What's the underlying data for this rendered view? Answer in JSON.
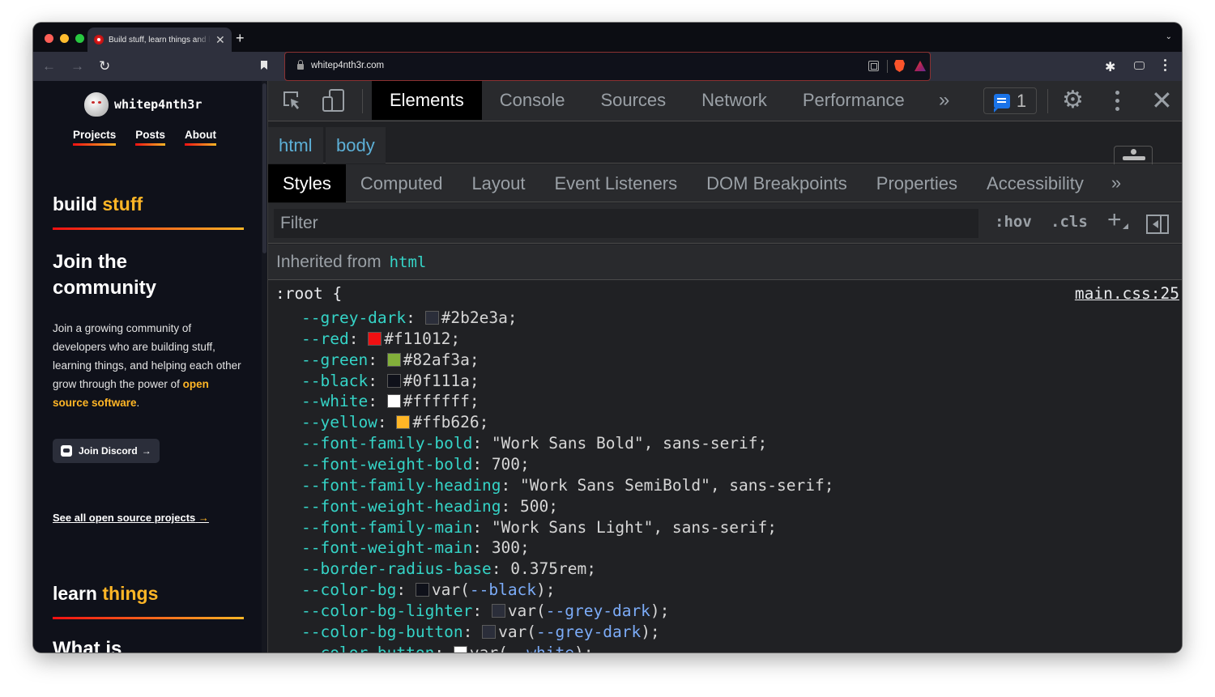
{
  "browser": {
    "tab_title": "Build stuff, learn things and love what you do",
    "new_tab_label": "+",
    "url": "whitep4nth3r.com"
  },
  "site": {
    "logo_text": "whitep4nth3r",
    "nav": [
      {
        "label": "Projects"
      },
      {
        "label": "Posts"
      },
      {
        "label": "About"
      }
    ],
    "section1": {
      "title_plain": "build",
      "title_highlight": "stuff"
    },
    "join_heading": "Join the community",
    "join_text_prefix": "Join a growing community of developers who are building stuff, learning things, and helping each other grow through the power of",
    "join_text_highlight": "open source software",
    "join_text_suffix": ".",
    "discord_button": "Join Discord",
    "discord_arrow": "→",
    "see_all_link": "See all open source projects",
    "see_all_arrow": "→",
    "section2": {
      "title_plain": "learn",
      "title_highlight": "things"
    },
    "what_is": "What is"
  },
  "devtools": {
    "tabs": [
      {
        "label": "Elements",
        "active": true
      },
      {
        "label": "Console",
        "active": false
      },
      {
        "label": "Sources",
        "active": false
      },
      {
        "label": "Network",
        "active": false
      },
      {
        "label": "Performance",
        "active": false
      }
    ],
    "more_tabs": "»",
    "issues_count": "1",
    "breadcrumbs": [
      {
        "label": "html"
      },
      {
        "label": "body"
      }
    ],
    "sub_tabs": [
      {
        "label": "Styles",
        "active": true
      },
      {
        "label": "Computed",
        "active": false
      },
      {
        "label": "Layout",
        "active": false
      },
      {
        "label": "Event Listeners",
        "active": false
      },
      {
        "label": "DOM Breakpoints",
        "active": false
      },
      {
        "label": "Properties",
        "active": false
      },
      {
        "label": "Accessibility",
        "active": false
      }
    ],
    "sub_more": "»",
    "filter_placeholder": "Filter",
    "hov_label": ":hov",
    "cls_label": ".cls",
    "inherited_label": "Inherited from",
    "inherited_tag": "html",
    "selector": ":root {",
    "source_link": "main.css:25",
    "declarations": [
      {
        "prop": "--grey-dark",
        "swatch": "#2b2e3a",
        "value": "#2b2e3a;"
      },
      {
        "prop": "--red",
        "swatch": "#f11012",
        "value": "#f11012;"
      },
      {
        "prop": "--green",
        "swatch": "#82af3a",
        "value": "#82af3a;"
      },
      {
        "prop": "--black",
        "swatch": "#0f111a",
        "value": "#0f111a;"
      },
      {
        "prop": "--white",
        "swatch": "#ffffff",
        "value": "#ffffff;"
      },
      {
        "prop": "--yellow",
        "swatch": "#ffb626",
        "value": "#ffb626;"
      },
      {
        "prop": "--font-family-bold",
        "value": "\"Work Sans Bold\", sans-serif;"
      },
      {
        "prop": "--font-weight-bold",
        "value": "700;"
      },
      {
        "prop": "--font-family-heading",
        "value": "\"Work Sans SemiBold\", sans-serif;"
      },
      {
        "prop": "--font-weight-heading",
        "value": "500;"
      },
      {
        "prop": "--font-family-main",
        "value": "\"Work Sans Light\", sans-serif;"
      },
      {
        "prop": "--font-weight-main",
        "value": "300;"
      },
      {
        "prop": "--border-radius-base",
        "value": "0.375rem;"
      },
      {
        "prop": "--color-bg",
        "swatch": "#0f111a",
        "var": "--black"
      },
      {
        "prop": "--color-bg-lighter",
        "swatch": "#2b2e3a",
        "var": "--grey-dark"
      },
      {
        "prop": "--color-bg-button",
        "swatch": "#2b2e3a",
        "var": "--grey-dark"
      },
      {
        "prop": "--color-button",
        "swatch": "#ffffff",
        "var": "--white"
      }
    ]
  }
}
